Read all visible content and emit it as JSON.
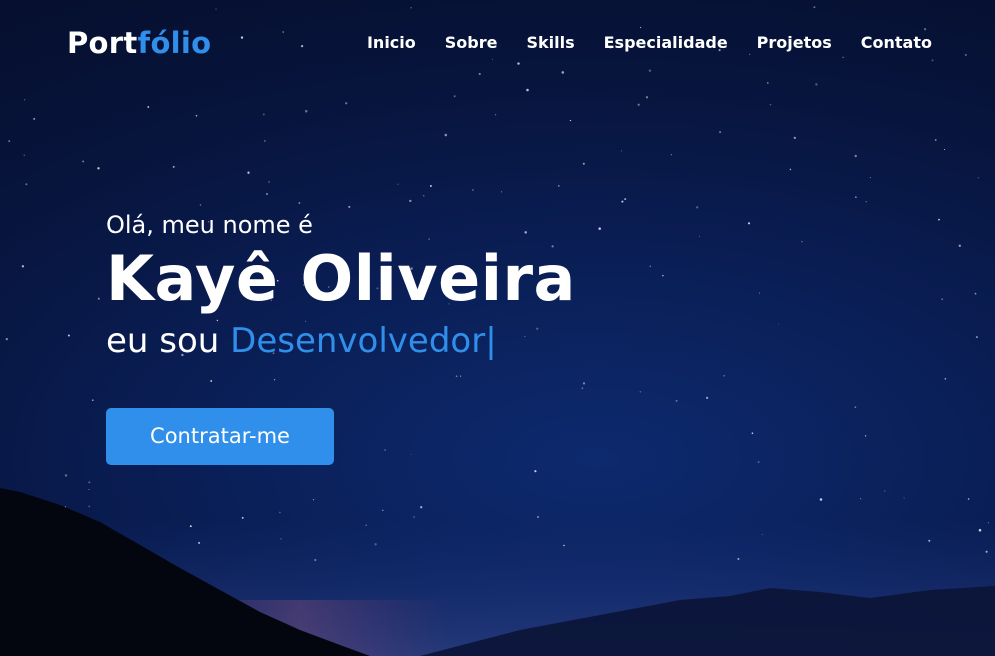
{
  "logo": {
    "part1": "Port",
    "part2": "fólio"
  },
  "nav": {
    "items": [
      "Inicio",
      "Sobre",
      "Skills",
      "Especialidade",
      "Projetos",
      "Contato"
    ]
  },
  "hero": {
    "greeting": "Olá, meu nome é",
    "name": "Kayê Oliveira",
    "role_prefix": "eu sou",
    "role_typed": "Desenvolvedor",
    "cursor": "|",
    "cta_label": "Contratar-me"
  },
  "colors": {
    "accent": "#2f8fea",
    "background": "#0a1e55",
    "text": "#ffffff"
  }
}
